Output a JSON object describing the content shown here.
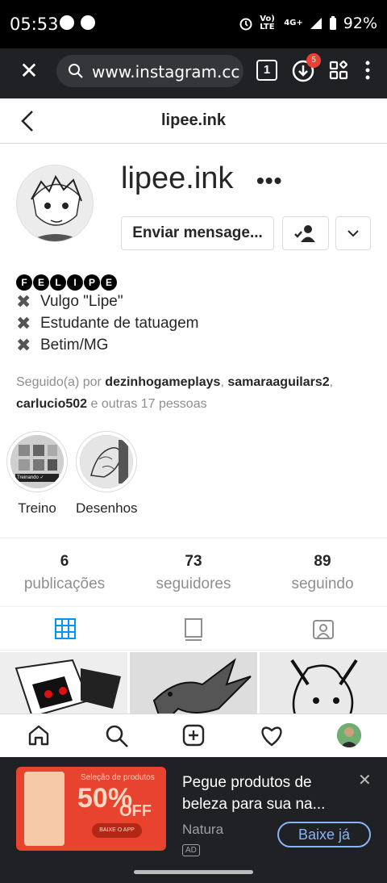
{
  "status_bar": {
    "time": "05:53",
    "network": "4G+",
    "volte": "Vo) LTE",
    "battery": "92%"
  },
  "browser": {
    "url": "www.instagram.cc",
    "tab_count": "1",
    "download_badge": "5"
  },
  "profile": {
    "header_title": "lipee.ink",
    "username": "lipee.ink",
    "more_label": "•••",
    "message_button": "Enviar mensage...",
    "bio_name_letters": [
      "F",
      "E",
      "L",
      "I",
      "P",
      "E"
    ],
    "bio_lines": [
      "Vulgo \"Lipe\"",
      "Estudante de tatuagem",
      "Betim/MG"
    ],
    "followed_by": {
      "prefix": "Seguido(a) por ",
      "users": [
        "dezinhogameplays",
        "samaraaguilars2",
        "carlucio502"
      ],
      "suffix": " e outras 17 pessoas"
    },
    "highlights": [
      {
        "label": "Treino",
        "badge": "Treinando ✓"
      },
      {
        "label": "Desenhos"
      }
    ],
    "stats": [
      {
        "value": "6",
        "label": "publicações"
      },
      {
        "value": "73",
        "label": "seguidores"
      },
      {
        "value": "89",
        "label": "seguindo"
      }
    ]
  },
  "ad": {
    "headline": "Pegue produtos de beleza para sua na...",
    "brand": "Natura",
    "ad_label": "AD",
    "install_label": "Baixe já",
    "creative": {
      "top_text": "Seleção de produtos",
      "discount": "50%",
      "off": "OFF",
      "cta": "BAIXE O APP"
    }
  }
}
